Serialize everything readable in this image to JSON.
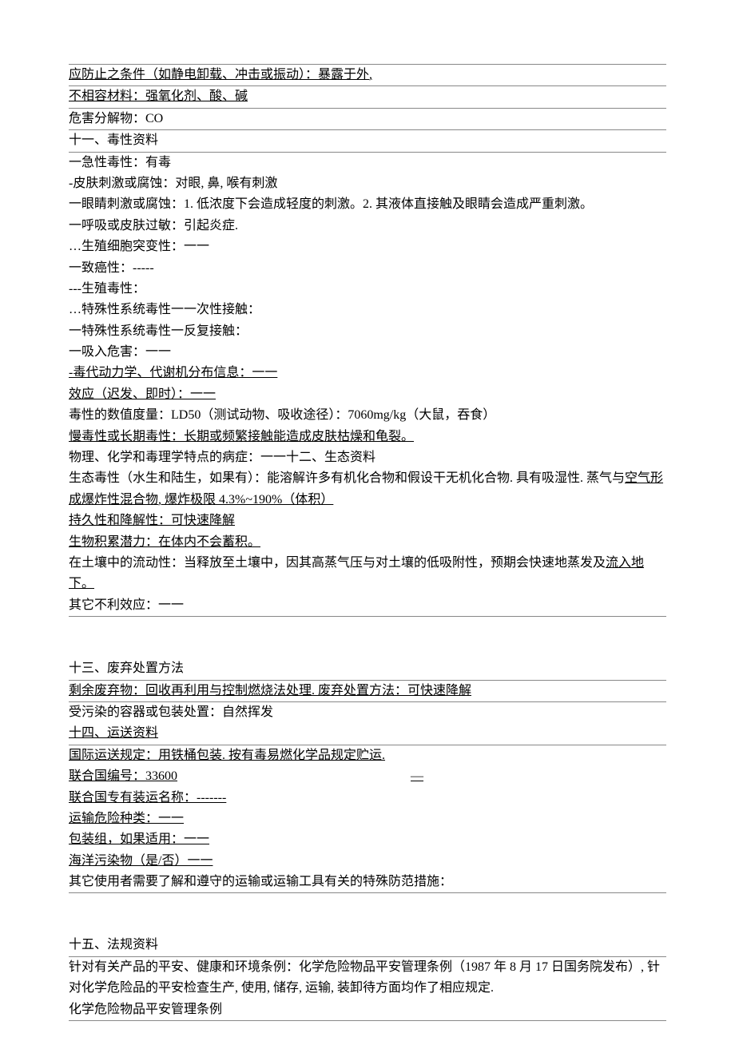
{
  "lines": [
    {
      "text": "应防止之条件（如静电卸载、冲击或振动）：暴露于外,",
      "ul": true,
      "borderTop": true
    },
    {
      "text": "不相容材料：强氧化剂、酸、碱",
      "ul": true,
      "borderTop": true
    },
    {
      "text": "危害分解物：CO",
      "borderTop": true,
      "borderBottom": true
    },
    {
      "text": "十一、毒性资料"
    },
    {
      "text": "一急性毒性：有毒",
      "borderTop": true
    },
    {
      "text": "-皮肤刺激或腐蚀：对眼, 鼻, 喉有刺激"
    },
    {
      "text": "一眼睛刺激或腐蚀：1. 低浓度下会造成轻度的刺激。2. 其液体直接触及眼睛会造成严重刺激。"
    },
    {
      "text": "一呼吸或皮肤过敏：引起炎症."
    },
    {
      "text": "…生殖细胞突变性：一一"
    },
    {
      "text": "一致癌性：-----"
    },
    {
      "text": "---生殖毒性："
    },
    {
      "text": "…特殊性系统毒性一一次性接触："
    },
    {
      "text": "一特殊性系统毒性一反复接触："
    },
    {
      "text": "一吸入危害：一一"
    },
    {
      "text": "-毒代动力学、代谢机分布信息：一一",
      "ul": true
    },
    {
      "text": "效应（迟发、即时）：一一",
      "ul": true
    },
    {
      "text": "毒性的数值度量：LD50（测试动物、吸收途径）：7060mg/kg（大鼠，吞食）"
    },
    {
      "text": "慢毒性或长期毒性：长期或频繁接触能造成皮肤枯燥和龟裂。",
      "ul": true
    },
    {
      "text": "物理、化学和毒理学特点的病症：一一十二、生态资料"
    },
    {
      "parts": [
        {
          "text": "生态毒性（水生和陆生，如果有）：能溶解许多有机化合物和假设干无机化合物. 具有吸湿性. 蒸气与"
        },
        {
          "text": "空气形成爆炸性混合物, 爆炸极限 4.3%~190%（体积）",
          "ul": true
        }
      ]
    },
    {
      "text": "持久性和降解性：可快速降解",
      "ul": true
    },
    {
      "text": "生物积累潜力：在体内不会蓄积。",
      "ul": true
    },
    {
      "parts": [
        {
          "text": "在土壤中的流动性：当释放至土壤中，因其高蒸气压与对土壤的低吸附性，预期会快速地蒸发及"
        },
        {
          "text": "流入地下。",
          "ul": true
        }
      ]
    },
    {
      "text": "其它不利效应：一一",
      "borderBottom": true
    },
    {
      "spacer": true
    },
    {
      "spacer": true
    },
    {
      "text": "十三、废弃处置方法",
      "borderBottom": true
    },
    {
      "text": "剩余废弃物：回收再利用与控制燃烧法处理. 废弃处置方法：可快速降解",
      "ul": true,
      "borderBottom": true
    },
    {
      "text": "受污染的容器或包装处置：自然挥发"
    },
    {
      "text": "十四、运送资料",
      "ul": true
    },
    {
      "text": "国际运送规定：用铁桶包装. 按有毒易燃化学品规定贮运.",
      "ul": true,
      "borderTop": true
    },
    {
      "parts": [
        {
          "text": "联合国编号：33600",
          "ul": true
        },
        {
          "text": "                                                                         "
        },
        {
          "text": "—",
          "ul": true
        }
      ]
    },
    {
      "text": "联合国专有装运名称：-------",
      "ul": true
    },
    {
      "text": "运输危险种类：一一",
      "ul": true
    },
    {
      "text": "包装组，如果适用：一一",
      "ul": true
    },
    {
      "text": "海洋污染物（是/否）一一",
      "ul": true
    },
    {
      "text": "其它使用者需要了解和遵守的运输或运输工具有关的特殊防范措施：",
      "borderBottom": true
    },
    {
      "spacer": true
    },
    {
      "spacer": true
    },
    {
      "text": "十五、法规资料"
    },
    {
      "text": "针对有关产品的平安、健康和环境条例：化学危险物品平安管理条例（1987 年 8 月 17 日国务院发布）, 针对化学危险品的平安检查生产, 使用, 储存, 运输, 装卸待方面均作了相应规定.",
      "borderTop": true
    },
    {
      "text": "化学危险物品平安管理条例",
      "borderBottom": true
    }
  ]
}
